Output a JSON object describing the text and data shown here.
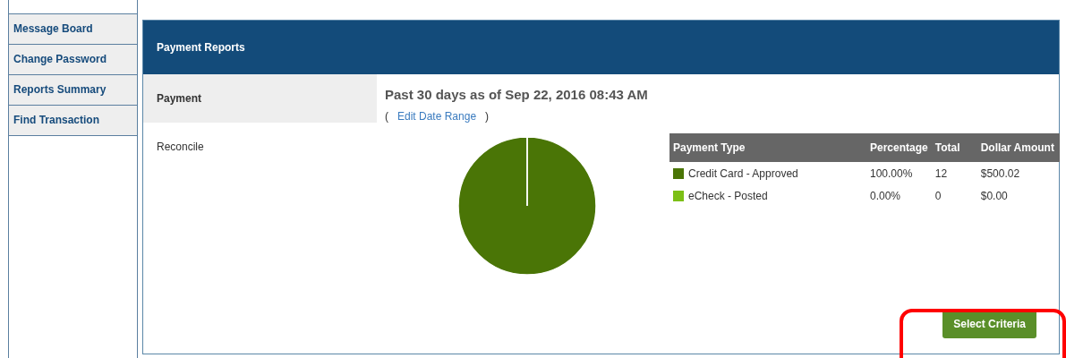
{
  "sidebar": {
    "items": [
      {
        "label": "Message Board"
      },
      {
        "label": "Change Password"
      },
      {
        "label": "Reports Summary"
      },
      {
        "label": "Find Transaction"
      }
    ]
  },
  "panel": {
    "title": "Payment Reports",
    "tabs": [
      {
        "label": "Payment",
        "selected": true
      },
      {
        "label": "Reconcile",
        "selected": false
      }
    ],
    "heading": "Past 30 days as of Sep 22, 2016 08:43 AM",
    "range": {
      "open": "(",
      "link": "Edit Date Range",
      "close": ")"
    },
    "chart_data": {
      "type": "pie",
      "values": [
        100,
        0
      ]
    },
    "table": {
      "columns": [
        "Payment Type",
        "Percentage",
        "Total",
        "Dollar Amount"
      ],
      "rows": [
        {
          "color": "#4a7506",
          "cells": [
            "Credit Card - Approved",
            "100.00%",
            "12",
            "$500.02"
          ]
        },
        {
          "color": "#7cbf16",
          "cells": [
            "eCheck - Posted",
            "0.00%",
            "0",
            "$0.00"
          ]
        }
      ]
    },
    "button": {
      "label": "Select Criteria",
      "highlighted": true
    }
  }
}
